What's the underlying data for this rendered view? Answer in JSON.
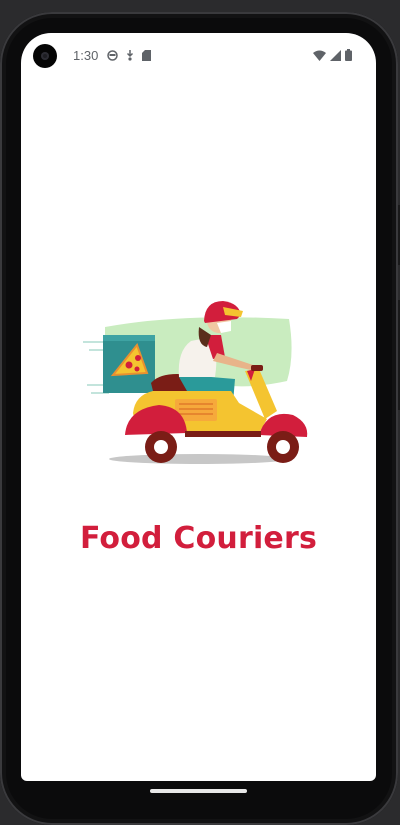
{
  "status_bar": {
    "time": "1:30",
    "left_icons": [
      "face-icon",
      "download-icon",
      "sd-card-icon"
    ],
    "right_icons": [
      "wifi-icon",
      "signal-icon",
      "battery-icon"
    ]
  },
  "splash": {
    "image_icon": "delivery-scooter-illustration",
    "title": "Food Couriers"
  },
  "colors": {
    "title": "#d21e3c",
    "background": "#ffffff",
    "frame": "#0b0b0c"
  }
}
